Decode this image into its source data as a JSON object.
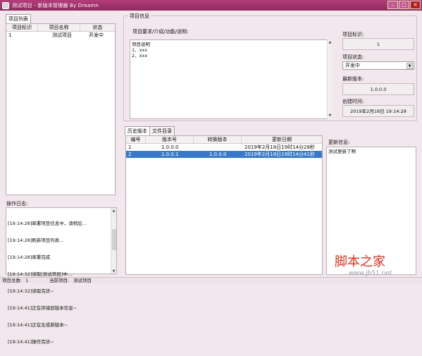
{
  "window": {
    "title": "测试项目 - 新版本管理器 By Dreamn",
    "minimize": "–",
    "restore": "□",
    "close": "✕"
  },
  "project_list": {
    "tab_label": "项目列表",
    "columns": [
      "项目标识",
      "项目名称",
      "状态"
    ],
    "rows": [
      [
        "1",
        "测试项目",
        "开发中"
      ]
    ]
  },
  "log": {
    "label": "操作日志:",
    "lines": [
      "[19:14:28]邮署项目信息中，请稍后...",
      "[19:14:28]刷新项目列表...",
      "[19:14:28]邮署完成",
      "[19:14:32]读取[测试项目]中...",
      "[19:14:32]读取完毕~",
      "[19:14:41]正在存储旧版本信息~",
      "[19:14:41]正在生成新版本~",
      "[19:14:41]操作完毕~"
    ]
  },
  "project_info": {
    "group_label": "项目信息",
    "desc_label": "项目要求/介绍/功能/说明:",
    "desc_text": "项目说明\n1、xxx\n2、xxx",
    "id_label": "项目标识:",
    "id_value": "1",
    "status_label": "项目状态:",
    "status_value": "开发中",
    "latest_version_label": "最新版本:",
    "latest_version_value": "1.0.0.0",
    "created_label": "创建时间:",
    "created_value": "2019年2月18日 19:14:28"
  },
  "history": {
    "tabs": [
      "历史版本",
      "文件目录"
    ],
    "columns": [
      "编号",
      "版本号",
      "转换版本",
      "更新日期"
    ],
    "rows": [
      [
        "1",
        "1.0.0.0",
        "",
        "2019年2月18日19时14分28秒"
      ],
      [
        "2",
        "1.0.0.1",
        "1.0.0.0",
        "2019年2月18日19时14分41秒"
      ]
    ],
    "selected_index": 1,
    "update_info_label": "更新信息:",
    "update_info_text": "测试更新了啊"
  },
  "statusbar": {
    "total_label": "项目总数:",
    "total_value": "1",
    "current_label": "当前项目:",
    "current_value": "测试项目"
  },
  "watermark": {
    "brand": "脚本之家",
    "url": "www.jb51.net"
  },
  "colors": {
    "titlebar": "#9b2f66",
    "selection": "#3a79c9",
    "background": "#f1e7ec"
  }
}
